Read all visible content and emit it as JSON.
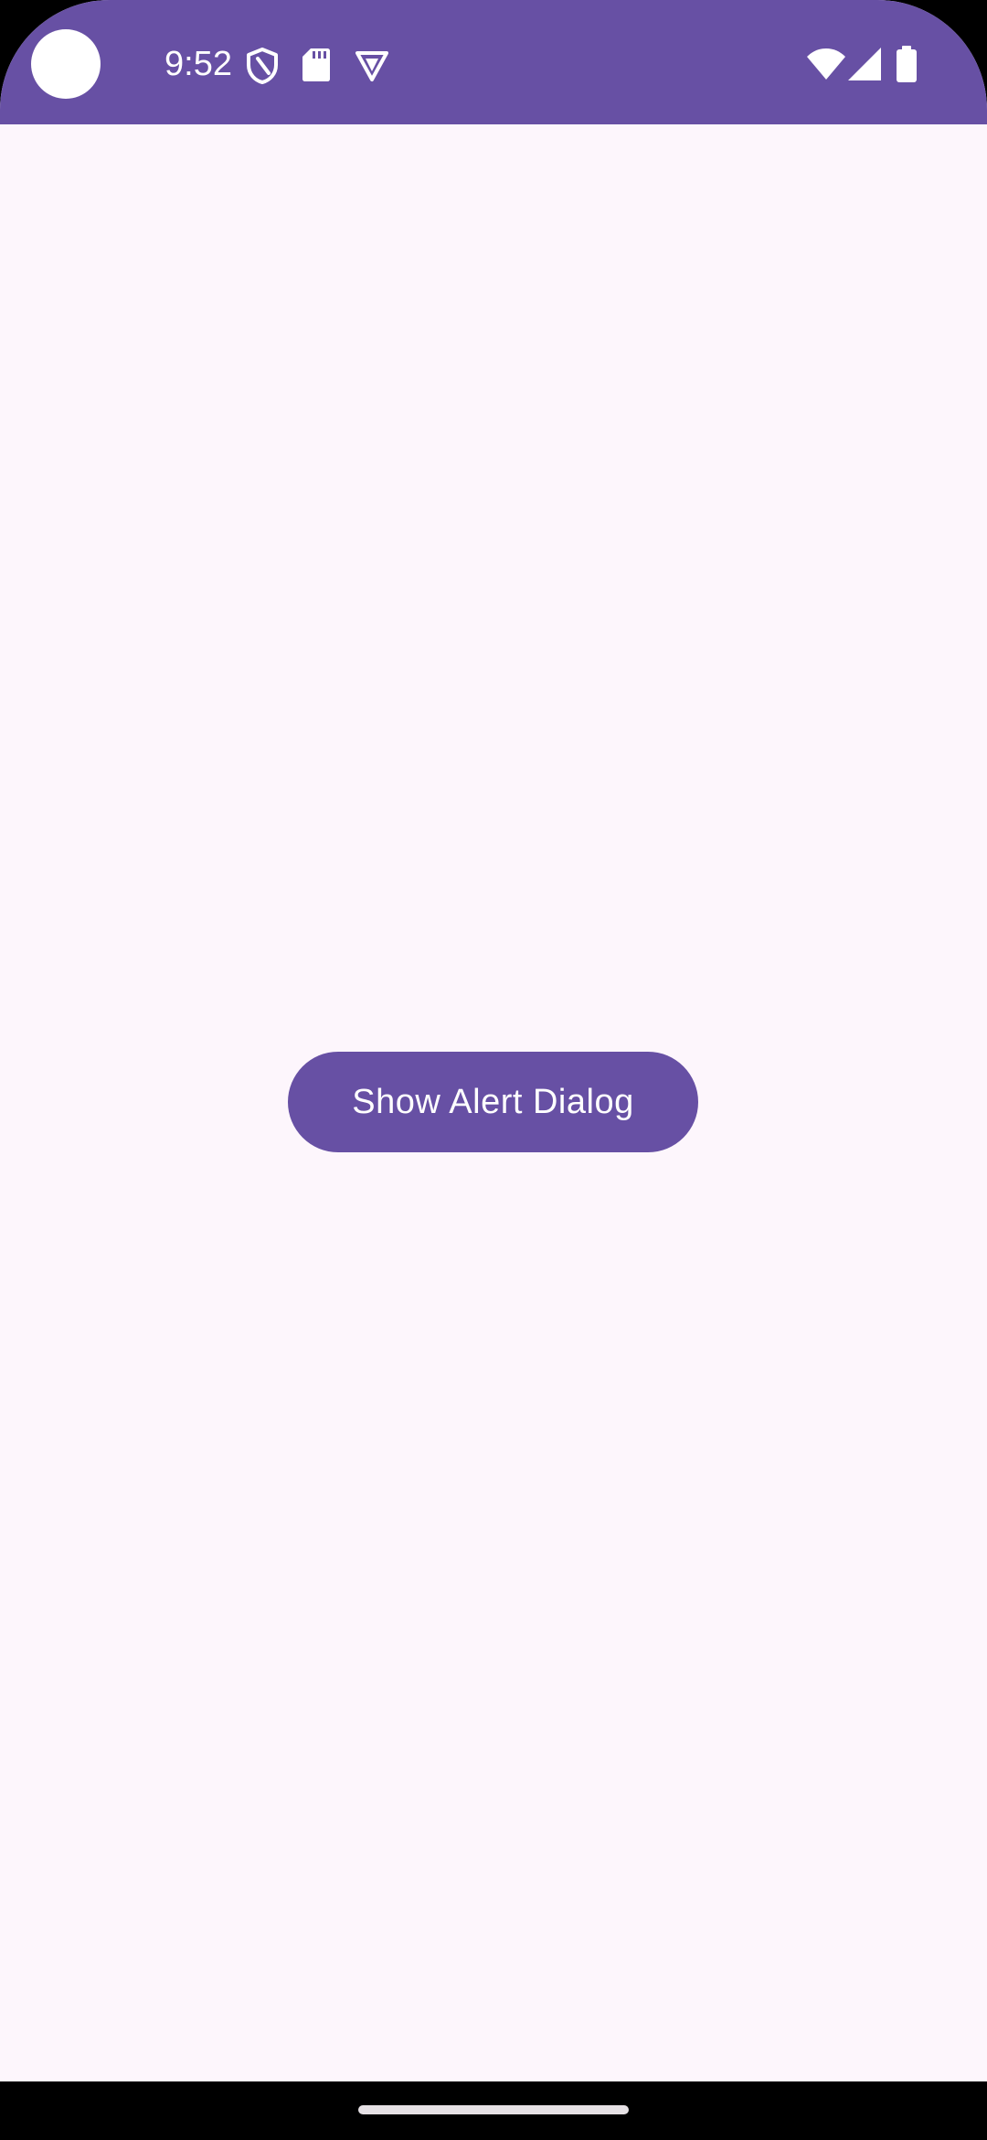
{
  "status_bar": {
    "time": "9:52",
    "icons": [
      "shield-icon",
      "sd-card-icon",
      "vpn-icon",
      "wifi-icon",
      "signal-icon",
      "battery-icon"
    ],
    "background_color": "#6750A4",
    "icon_color": "#FFFFFF"
  },
  "main": {
    "background_color": "#FDF6FC",
    "show_alert_button_label": "Show Alert Dialog",
    "button_color": "#6750A4",
    "button_text_color": "#FFFFFF"
  },
  "navigation": {
    "home_indicator": "home-indicator"
  }
}
